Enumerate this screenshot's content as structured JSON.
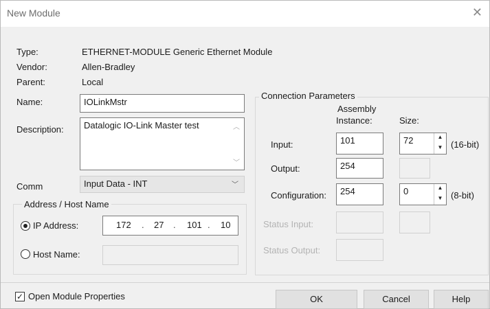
{
  "window": {
    "title": "New Module",
    "close_glyph": "✕"
  },
  "info": {
    "type_label": "Type:",
    "type_value": "ETHERNET-MODULE Generic Ethernet Module",
    "vendor_label": "Vendor:",
    "vendor_value": "Allen-Bradley",
    "parent_label": "Parent:",
    "parent_value": "Local",
    "name_label": "Name:",
    "name_value": "IOLinkMstr",
    "description_label": "Description:",
    "description_value": "Datalogic IO-Link Master test",
    "comm_label": "Comm",
    "comm_value": "Input Data - INT"
  },
  "address": {
    "group_label": "Address / Host Name",
    "ip_label": "IP Address:",
    "ip_octets": [
      "172",
      "27",
      "101",
      "10"
    ],
    "host_label": "Host Name:",
    "ip_selected": true
  },
  "connection": {
    "group_label": "Connection Parameters",
    "assembly_header": "Assembly",
    "instance_header": "Instance:",
    "size_header": "Size:",
    "input_label": "Input:",
    "input_instance": "101",
    "input_size": "72",
    "input_unit": "(16-bit)",
    "output_label": "Output:",
    "output_instance": "254",
    "config_label": "Configuration:",
    "config_instance": "254",
    "config_size": "0",
    "config_unit": "(8-bit)",
    "status_input_label": "Status Input:",
    "status_output_label": "Status Output:"
  },
  "footer": {
    "open_props_label": "Open Module Properties",
    "open_props_checked": true,
    "ok_label": "OK",
    "cancel_label": "Cancel",
    "help_label": "Help"
  }
}
